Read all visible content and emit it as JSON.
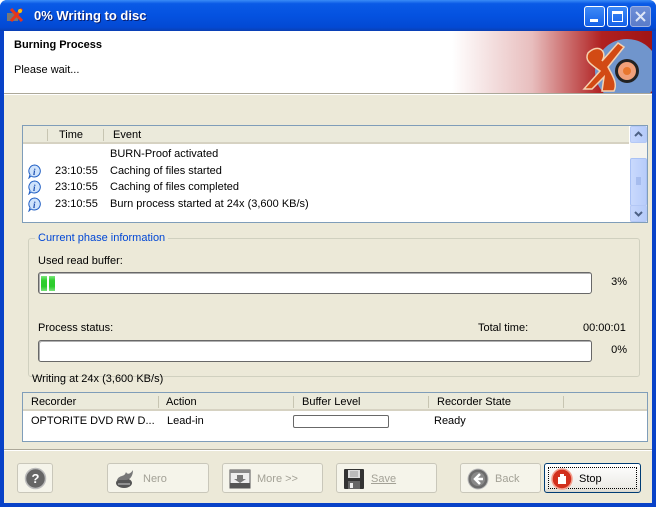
{
  "window": {
    "title": "0% Writing to disc",
    "controls": {
      "minimize": "minimize",
      "maximize": "maximize",
      "close": "close"
    }
  },
  "header": {
    "title": "Burning Process",
    "subtitle": "Please wait..."
  },
  "event_log": {
    "columns": [
      "",
      "Time",
      "Event"
    ],
    "rows": [
      {
        "icon": "",
        "time": "",
        "event": "BURN-Proof activated"
      },
      {
        "icon": "info-icon",
        "time": "23:10:55",
        "event": "Caching of files started"
      },
      {
        "icon": "info-icon",
        "time": "23:10:55",
        "event": "Caching of files completed"
      },
      {
        "icon": "info-icon",
        "time": "23:10:55",
        "event": "Burn process started at 24x (3,600 KB/s)"
      }
    ]
  },
  "phase": {
    "legend": "Current phase information",
    "read_buffer_label": "Used read buffer:",
    "read_buffer_percent": 3,
    "read_buffer_text": "3%",
    "process_status_label": "Process status:",
    "total_time_label": "Total time:",
    "total_time_value": "00:00:01",
    "process_percent": 0,
    "process_text": "0%"
  },
  "writing_status": "Writing at 24x (3,600 KB/s)",
  "recorders": {
    "columns": [
      "Recorder",
      "Action",
      "Buffer Level",
      "Recorder State"
    ],
    "rows": [
      {
        "recorder": "OPTORITE DVD RW D...",
        "action": "Lead-in",
        "buffer_level": 0,
        "state": "Ready"
      }
    ]
  },
  "buttons": {
    "help": "?",
    "nero": "Nero",
    "more": "More >>",
    "save": "Save",
    "back": "Back",
    "stop": "Stop"
  },
  "colors": {
    "titlebar": "#0452e0",
    "progress_green": "#2ccc2c",
    "group_legend": "#0046d5"
  }
}
